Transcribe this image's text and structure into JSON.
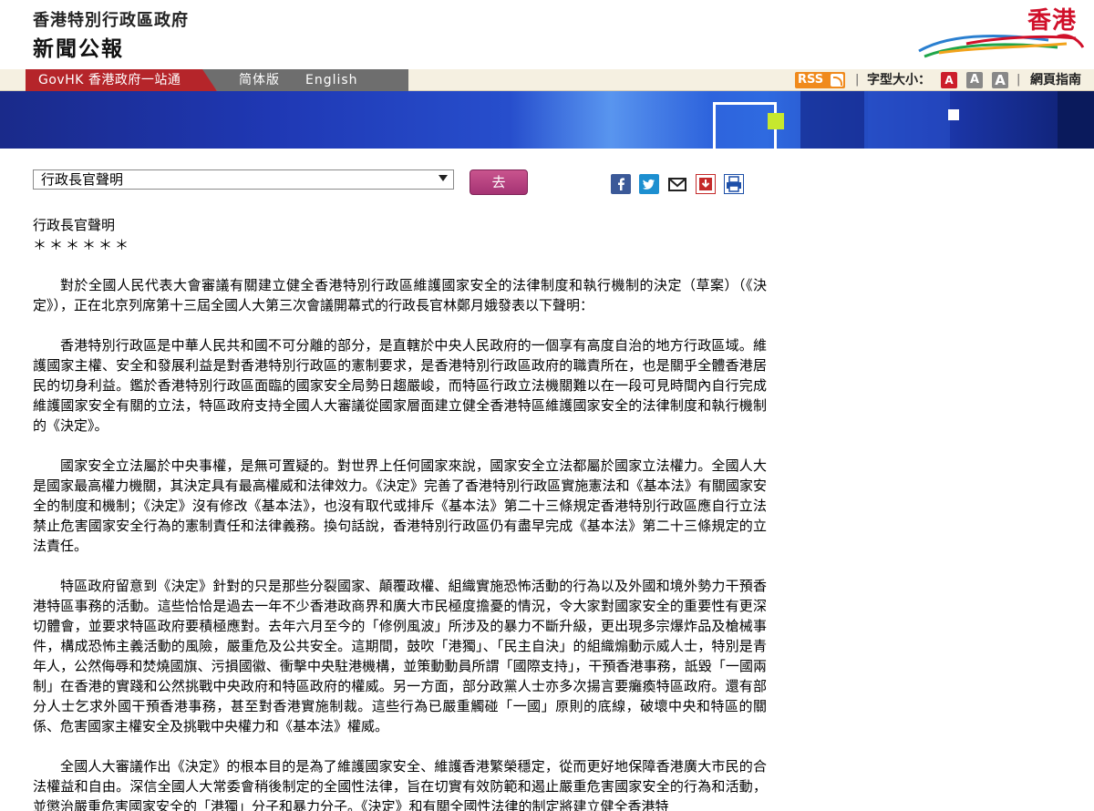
{
  "header": {
    "org_title": "香港特別行政區政府",
    "press_title": "新聞公報",
    "brand_text": "香港"
  },
  "nav": {
    "govhk_label": "GovHK 香港政府一站通",
    "simplified_label": "简体版",
    "english_label": "English",
    "rss_label": "RSS",
    "fontsize_label": "字型大小：",
    "fontsize_options": [
      "A",
      "A",
      "A"
    ],
    "sitemap_label": "網頁指南"
  },
  "search": {
    "selected_category": "行政長官聲明",
    "go_label": "去"
  },
  "share_icons": [
    "facebook-icon",
    "twitter-icon",
    "mail-icon",
    "save-icon",
    "print-icon"
  ],
  "article": {
    "title": "行政長官聲明",
    "stars": "＊＊＊＊＊＊",
    "paragraphs": [
      "對於全國人民代表大會審議有關建立健全香港特別行政區維護國家安全的法律制度和執行機制的決定（草案）（《決定》），正在北京列席第十三屆全國人大第三次會議開幕式的行政長官林鄭月娥發表以下聲明：",
      "香港特別行政區是中華人民共和國不可分離的部分，是直轄於中央人民政府的一個享有高度自治的地方行政區域。維護國家主權、安全和發展利益是對香港特別行政區的憲制要求，是香港特別行政區政府的職責所在，也是關乎全體香港居民的切身利益。鑑於香港特別行政區面臨的國家安全局勢日趨嚴峻，而特區行政立法機關難以在一段可見時間內自行完成維護國家安全有關的立法，特區政府支持全國人大審議從國家層面建立健全香港特區維護國家安全的法律制度和執行機制的《決定》。",
      "國家安全立法屬於中央事權，是無可置疑的。對世界上任何國家來說，國家安全立法都屬於國家立法權力。全國人大是國家最高權力機關，其決定具有最高權威和法律效力。《決定》完善了香港特別行政區實施憲法和《基本法》有關國家安全的制度和機制；《決定》沒有修改《基本法》，也沒有取代或排斥《基本法》第二十三條規定香港特別行政區應自行立法禁止危害國家安全行為的憲制責任和法律義務。換句話說，香港特別行政區仍有盡早完成《基本法》第二十三條規定的立法責任。",
      "特區政府留意到《決定》針對的只是那些分裂國家、顛覆政權、組織實施恐怖活動的行為以及外國和境外勢力干預香港特區事務的活動。這些恰恰是過去一年不少香港政商界和廣大市民極度擔憂的情況，令大家對國家安全的重要性有更深切體會，並要求特區政府要積極應對。去年六月至今的「修例風波」所涉及的暴力不斷升級，更出現多宗爆炸品及槍械事件，構成恐怖主義活動的風險，嚴重危及公共安全。這期間，鼓吹「港獨」、「民主自決」的組織煽動示威人士，特別是青年人，公然侮辱和焚燒國旗、污損國徽、衝擊中央駐港機構，並策動動員所謂「國際支持」，干預香港事務，詆毀「一國兩制」在香港的實踐和公然挑戰中央政府和特區政府的權威。另一方面，部分政黨人士亦多次揚言要癱瘓特區政府。還有部分人士乞求外國干預香港事務，甚至對香港實施制裁。這些行為已嚴重觸碰「一國」原則的底線，破壞中央和特區的關係、危害國家主權安全及挑戰中央權力和《基本法》權威。",
      "全國人大審議作出《決定》的根本目的是為了維護國家安全、維護香港繁榮穩定，從而更好地保障香港廣大市民的合法權益和自由。深信全國人大常委會稍後制定的全國性法律，旨在切實有效防範和遏止嚴重危害國家安全的行為和活動，並懲治嚴重危害國家安全的「港獨」分子和暴力分子。《決定》和有關全國性法律的制定將建立健全香港特"
    ]
  }
}
